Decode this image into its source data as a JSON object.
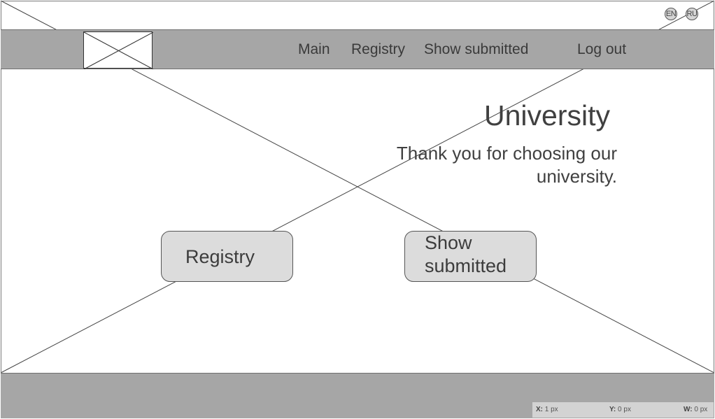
{
  "languages": [
    "EN",
    "RU"
  ],
  "header": {
    "logo": "image-placeholder",
    "nav": [
      {
        "label": "Main"
      },
      {
        "label": "Registry"
      },
      {
        "label": "Show submitted"
      },
      {
        "label": "Log out"
      }
    ]
  },
  "hero": {
    "title": "University",
    "subtitle": "Thank you for choosing our university."
  },
  "actions": {
    "registry_label": "Registry",
    "show_submitted_label": "Show submitted"
  },
  "status": {
    "x_label": "X:",
    "x_value": "1 px",
    "y_label": "Y:",
    "y_value": "0 px",
    "w_label": "W:",
    "w_value": "0 px"
  },
  "colors": {
    "header_bg": "#a6a6a6",
    "button_bg": "#dcdcdc",
    "text": "#404040"
  }
}
